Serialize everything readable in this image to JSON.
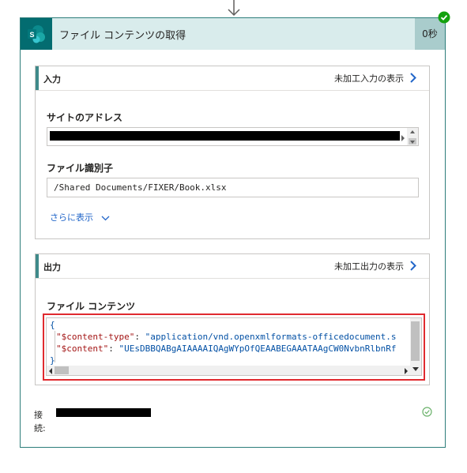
{
  "action": {
    "title": "ファイル コンテンツの取得",
    "duration": "0秒"
  },
  "input": {
    "title": "入力",
    "raw_link": "未加工入力の表示",
    "site_address_label": "サイトのアドレス",
    "file_id_label": "ファイル識別子",
    "file_id_value": "/Shared Documents/FIXER/Book.xlsx",
    "show_more": "さらに表示"
  },
  "output": {
    "title": "出力",
    "raw_link": "未加工出力の表示",
    "file_content_label": "ファイル コンテンツ",
    "json": {
      "open_brace": "{",
      "line1_key": "\"$content-type\"",
      "line1_sep": ": ",
      "line1_value": "\"application/vnd.openxmlformats-officedocument.s",
      "line2_key": "\"$content\"",
      "line2_sep": ": ",
      "line2_value": "\"UEsDBBQABgAIAAAAIQAgWYpOfQEAABEGAAATAAgCW0NvbnRlbnRf",
      "close_brace": "}"
    }
  },
  "connection": {
    "label": "接\n続:"
  },
  "colors": {
    "header_bg": "#d9ecec",
    "sharepoint_icon": "#036c70",
    "success_badge": "#13a10e",
    "highlight_border": "#e02a2f",
    "link": "#2266c9"
  }
}
